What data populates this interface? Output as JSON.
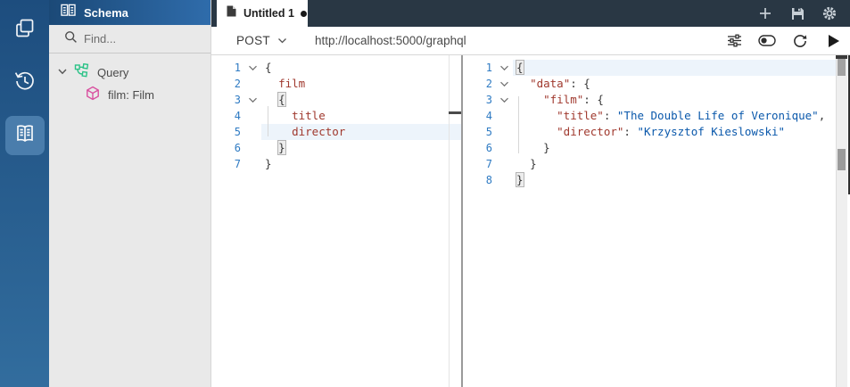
{
  "colors": {
    "sidebar_top": "#1d4d7e",
    "sidebar_bottom": "#326d9e",
    "active_tile": "#4a7dac",
    "header_start": "#1b4977",
    "header_end": "#2f6cab",
    "tabbar_bg": "#293744",
    "line_number_color": "#2f7bc3",
    "key_color": "#a0392e",
    "string_color": "#0a58ab",
    "punct_color": "#383838",
    "highlight_line": "#edf4fb",
    "type_icon_color": "#2bc287",
    "field_icon_color": "#d94f9f"
  },
  "sidebar": {
    "items": [
      {
        "id": "collections",
        "icon": "copy-icon"
      },
      {
        "id": "history",
        "icon": "history-icon"
      },
      {
        "id": "schema-docs",
        "icon": "book-icon",
        "active": true
      }
    ]
  },
  "schema_panel": {
    "title": "Schema",
    "find_placeholder": "Find...",
    "tree": [
      {
        "label": "Query",
        "icon": "type-icon",
        "expandable": true
      },
      {
        "label": "film: Film",
        "icon": "field-cube-icon"
      }
    ]
  },
  "tab_bar": {
    "tabs": [
      {
        "label": "Untitled 1",
        "dirty": true,
        "active": true
      }
    ]
  },
  "request_bar": {
    "method": "POST",
    "url": "http://localhost:5000/graphql"
  },
  "query_editor": {
    "lines": [
      {
        "n": "1",
        "fold": true,
        "segs": [
          {
            "t": "{",
            "c": "p"
          }
        ]
      },
      {
        "n": "2",
        "segs": [
          {
            "t": "  ",
            "c": "p"
          },
          {
            "t": "film",
            "c": "key"
          }
        ]
      },
      {
        "n": "3",
        "fold": true,
        "segs": [
          {
            "t": "  ",
            "c": "p"
          },
          {
            "t": "{",
            "c": "p",
            "b": true
          }
        ]
      },
      {
        "n": "4",
        "segs": [
          {
            "t": "    ",
            "c": "p"
          },
          {
            "t": "title",
            "c": "key"
          }
        ]
      },
      {
        "n": "5",
        "hl": true,
        "segs": [
          {
            "t": "    ",
            "c": "p"
          },
          {
            "t": "director",
            "c": "key"
          }
        ]
      },
      {
        "n": "6",
        "segs": [
          {
            "t": "  ",
            "c": "p"
          },
          {
            "t": "}",
            "c": "p",
            "b": true
          }
        ]
      },
      {
        "n": "7",
        "segs": [
          {
            "t": "}",
            "c": "p"
          }
        ]
      }
    ]
  },
  "response_editor": {
    "lines": [
      {
        "n": "1",
        "fold": true,
        "hl": true,
        "segs": [
          {
            "t": "{",
            "c": "p",
            "b": true
          }
        ]
      },
      {
        "n": "2",
        "fold": true,
        "segs": [
          {
            "t": "  ",
            "c": "p"
          },
          {
            "t": "\"data\"",
            "c": "key"
          },
          {
            "t": ": {",
            "c": "p"
          }
        ]
      },
      {
        "n": "3",
        "fold": true,
        "segs": [
          {
            "t": "    ",
            "c": "p"
          },
          {
            "t": "\"film\"",
            "c": "key"
          },
          {
            "t": ": {",
            "c": "p"
          }
        ]
      },
      {
        "n": "4",
        "segs": [
          {
            "t": "      ",
            "c": "p"
          },
          {
            "t": "\"title\"",
            "c": "key"
          },
          {
            "t": ": ",
            "c": "p"
          },
          {
            "t": "\"The Double Life of Veronique\"",
            "c": "str"
          },
          {
            "t": ",",
            "c": "p"
          }
        ]
      },
      {
        "n": "5",
        "segs": [
          {
            "t": "      ",
            "c": "p"
          },
          {
            "t": "\"director\"",
            "c": "key"
          },
          {
            "t": ": ",
            "c": "p"
          },
          {
            "t": "\"Krzysztof Kieslowski\"",
            "c": "str"
          }
        ]
      },
      {
        "n": "6",
        "segs": [
          {
            "t": "    ",
            "c": "p"
          },
          {
            "t": "}",
            "c": "p"
          }
        ]
      },
      {
        "n": "7",
        "segs": [
          {
            "t": "  ",
            "c": "p"
          },
          {
            "t": "}",
            "c": "p"
          }
        ]
      },
      {
        "n": "8",
        "segs": [
          {
            "t": "}",
            "c": "p",
            "b": true
          }
        ]
      }
    ]
  }
}
